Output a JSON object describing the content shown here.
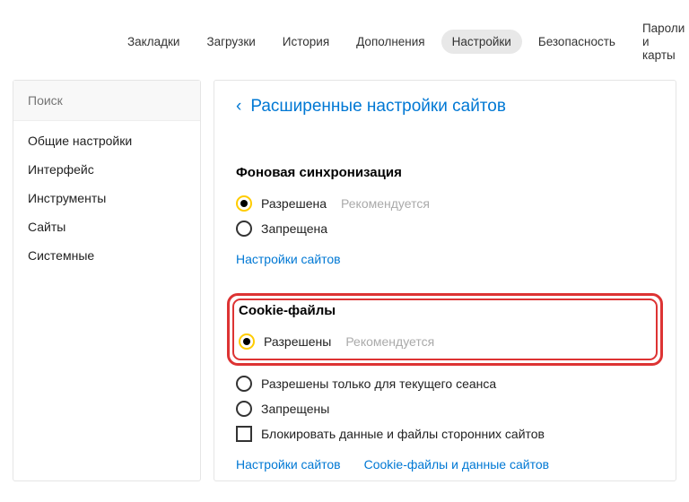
{
  "topnav": {
    "items": [
      {
        "label": "Закладки"
      },
      {
        "label": "Загрузки"
      },
      {
        "label": "История"
      },
      {
        "label": "Дополнения"
      },
      {
        "label": "Настройки",
        "active": true
      },
      {
        "label": "Безопасность"
      },
      {
        "label": "Пароли и карты"
      }
    ]
  },
  "sidebar": {
    "search_placeholder": "Поиск",
    "items": [
      {
        "label": "Общие настройки"
      },
      {
        "label": "Интерфейс"
      },
      {
        "label": "Инструменты"
      },
      {
        "label": "Сайты"
      },
      {
        "label": "Системные"
      }
    ]
  },
  "main": {
    "back_label": "Расширенные настройки сайтов",
    "sync": {
      "title": "Фоновая синхронизация",
      "allowed": "Разрешена",
      "hint": "Рекомендуется",
      "denied": "Запрещена",
      "link": "Настройки сайтов"
    },
    "cookies": {
      "title": "Cookie-файлы",
      "allowed": "Разрешены",
      "hint": "Рекомендуется",
      "session": "Разрешены только для текущего сеанса",
      "denied": "Запрещены",
      "block3rd": "Блокировать данные и файлы сторонних сайтов",
      "link1": "Настройки сайтов",
      "link2": "Cookie-файлы и данные сайтов"
    }
  }
}
